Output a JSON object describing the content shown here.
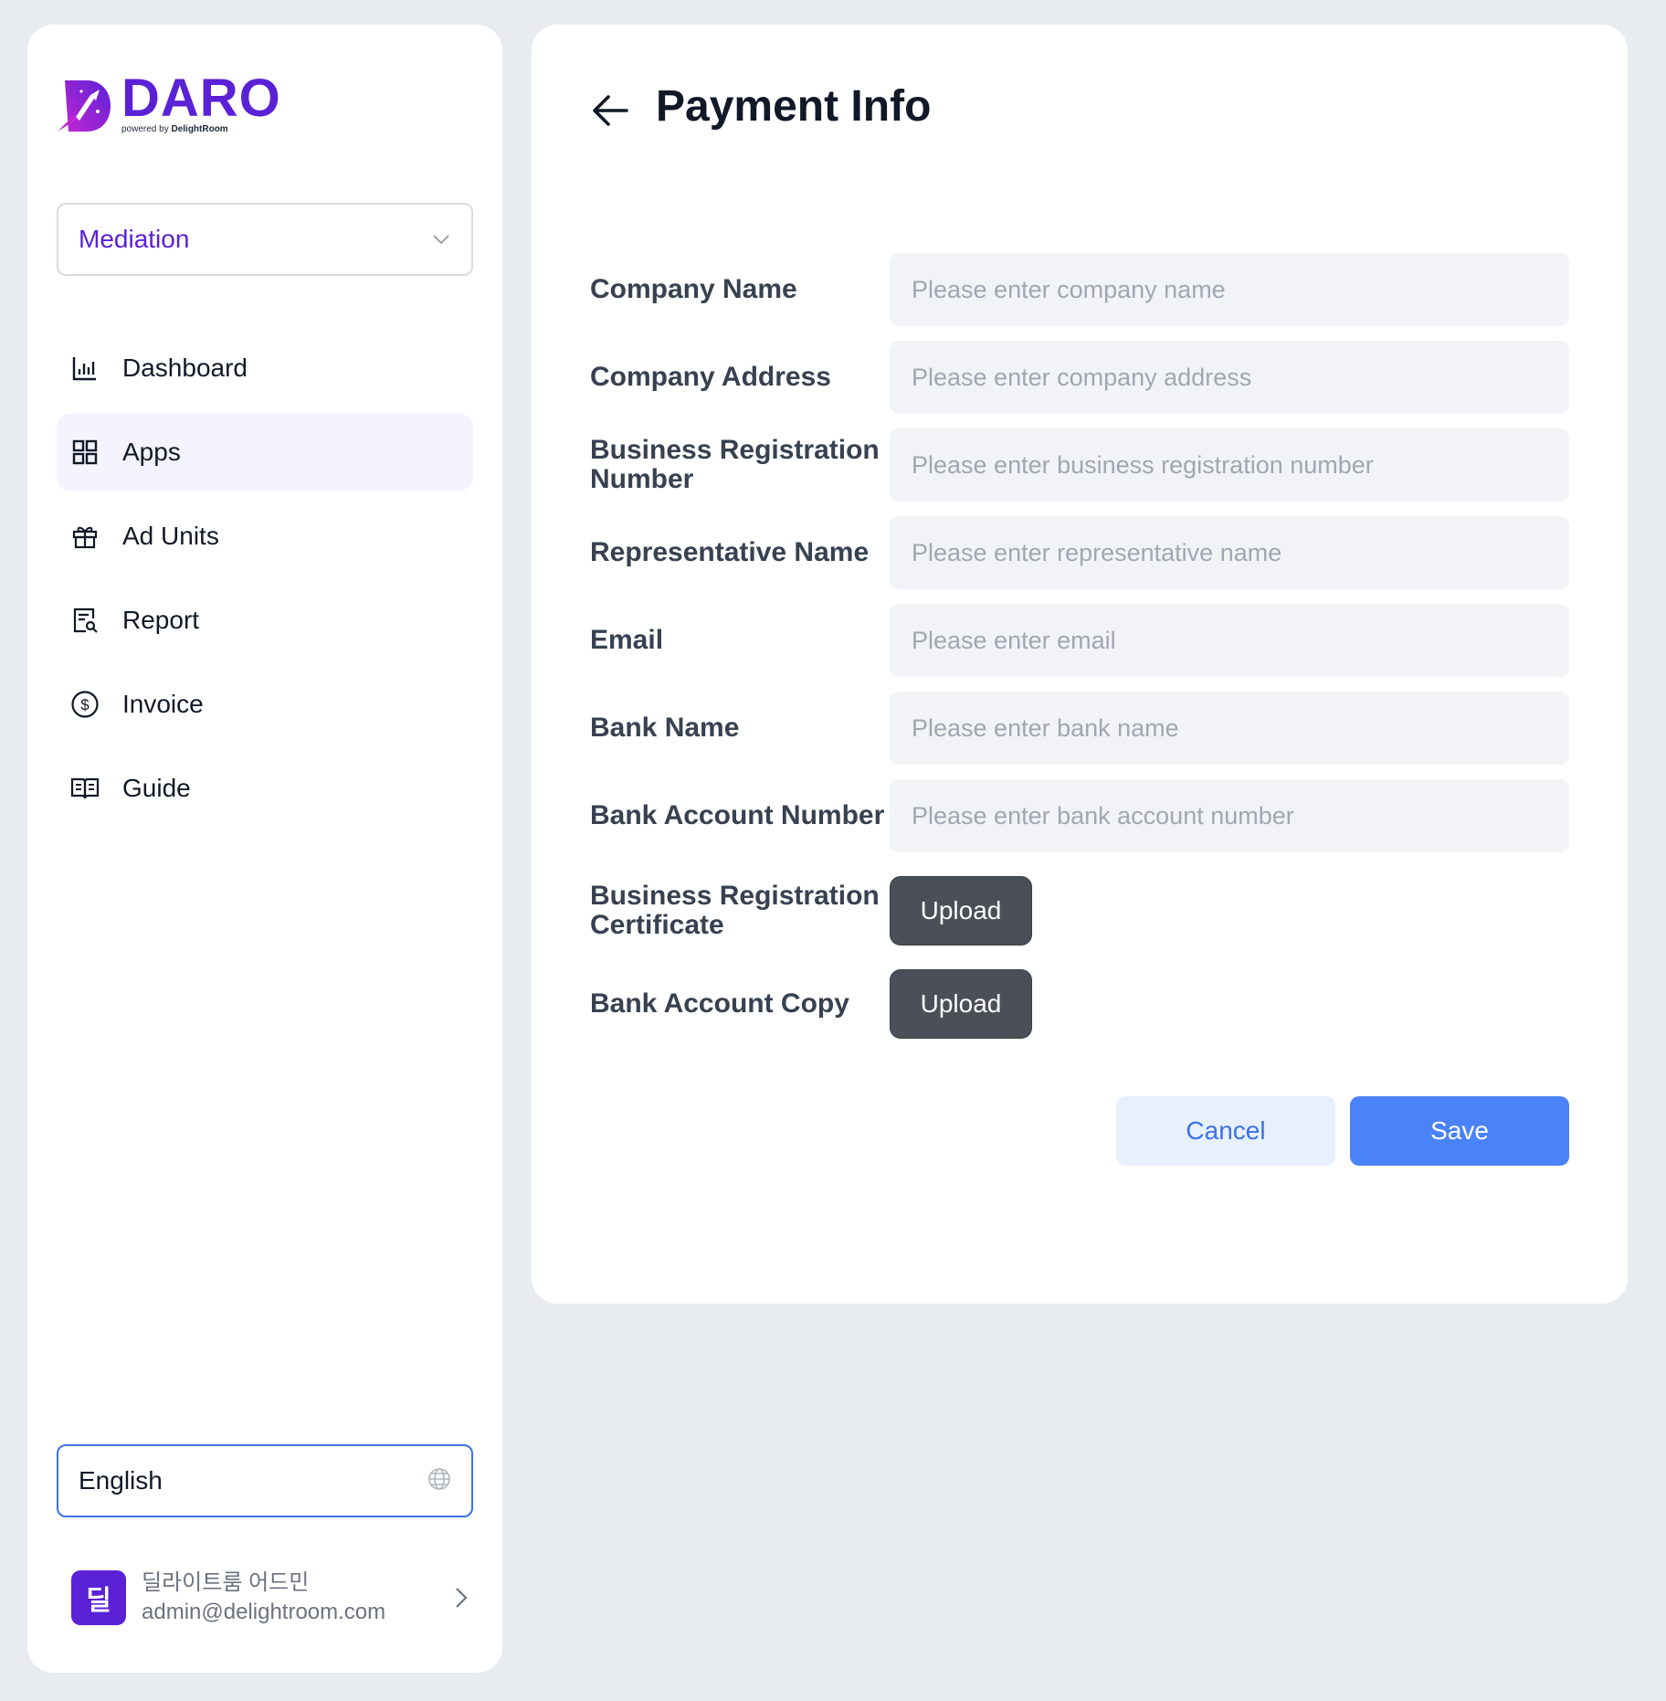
{
  "brand": {
    "name": "DARO",
    "powered_prefix": "powered by",
    "powered_company": "DelightRoom",
    "primary_color": "#5b21d6"
  },
  "sidebar": {
    "mediation_select": {
      "value": "Mediation",
      "icon": "chevron-down-icon"
    },
    "items": [
      {
        "label": "Dashboard",
        "icon": "bar-chart-icon",
        "active": false
      },
      {
        "label": "Apps",
        "icon": "grid-icon",
        "active": true
      },
      {
        "label": "Ad Units",
        "icon": "gift-icon",
        "active": false
      },
      {
        "label": "Report",
        "icon": "report-search-icon",
        "active": false
      },
      {
        "label": "Invoice",
        "icon": "dollar-circle-icon",
        "active": false
      },
      {
        "label": "Guide",
        "icon": "book-icon",
        "active": false
      }
    ],
    "language_select": {
      "value": "English",
      "icon": "globe-icon"
    },
    "user": {
      "avatar_char": "딜",
      "name": "딜라이트룸 어드민",
      "email": "admin@delightroom.com"
    }
  },
  "main": {
    "title": "Payment Info",
    "fields": [
      {
        "label": "Company Name",
        "placeholder": "Please enter company name"
      },
      {
        "label": "Company Address",
        "placeholder": "Please enter company address"
      },
      {
        "label": "Business Registration Number",
        "placeholder": "Please enter business registration number"
      },
      {
        "label": "Representative Name",
        "placeholder": "Please enter representative name"
      },
      {
        "label": "Email",
        "placeholder": "Please enter email"
      },
      {
        "label": "Bank Name",
        "placeholder": "Please enter bank name"
      },
      {
        "label": "Bank Account Number",
        "placeholder": "Please enter bank account number"
      }
    ],
    "uploads": [
      {
        "label": "Business Registration Certificate",
        "button": "Upload"
      },
      {
        "label": "Bank Account Copy",
        "button": "Upload"
      }
    ],
    "actions": {
      "cancel": "Cancel",
      "save": "Save"
    },
    "colors": {
      "save": "#4a82f7",
      "cancel_bg": "#e8f0fe",
      "upload": "#4a4f58"
    }
  }
}
